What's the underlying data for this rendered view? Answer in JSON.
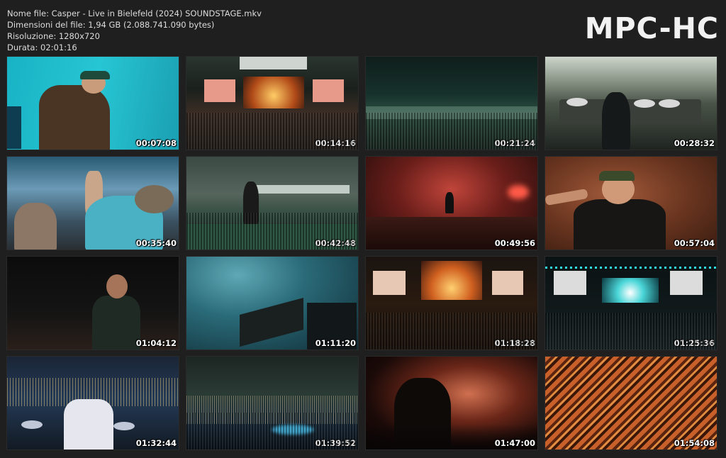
{
  "header": {
    "file_name": "Nome file: Casper - Live in Bielefeld (2024) SOUNDSTAGE.mkv",
    "file_size": "Dimensioni del file: 1,94 GB (2.088.741.090 bytes)",
    "resolution": "Risoluzione: 1280x720",
    "duration": "Durata: 02:01:16",
    "logo": "MPC-HC"
  },
  "thumbnails": [
    {
      "time": "00:07:08"
    },
    {
      "time": "00:14:16"
    },
    {
      "time": "00:21:24"
    },
    {
      "time": "00:28:32"
    },
    {
      "time": "00:35:40"
    },
    {
      "time": "00:42:48"
    },
    {
      "time": "00:49:56"
    },
    {
      "time": "00:57:04"
    },
    {
      "time": "01:04:12"
    },
    {
      "time": "01:11:20"
    },
    {
      "time": "01:18:28"
    },
    {
      "time": "01:25:36"
    },
    {
      "time": "01:32:44"
    },
    {
      "time": "01:39:52"
    },
    {
      "time": "01:47:00"
    },
    {
      "time": "01:54:08"
    }
  ]
}
